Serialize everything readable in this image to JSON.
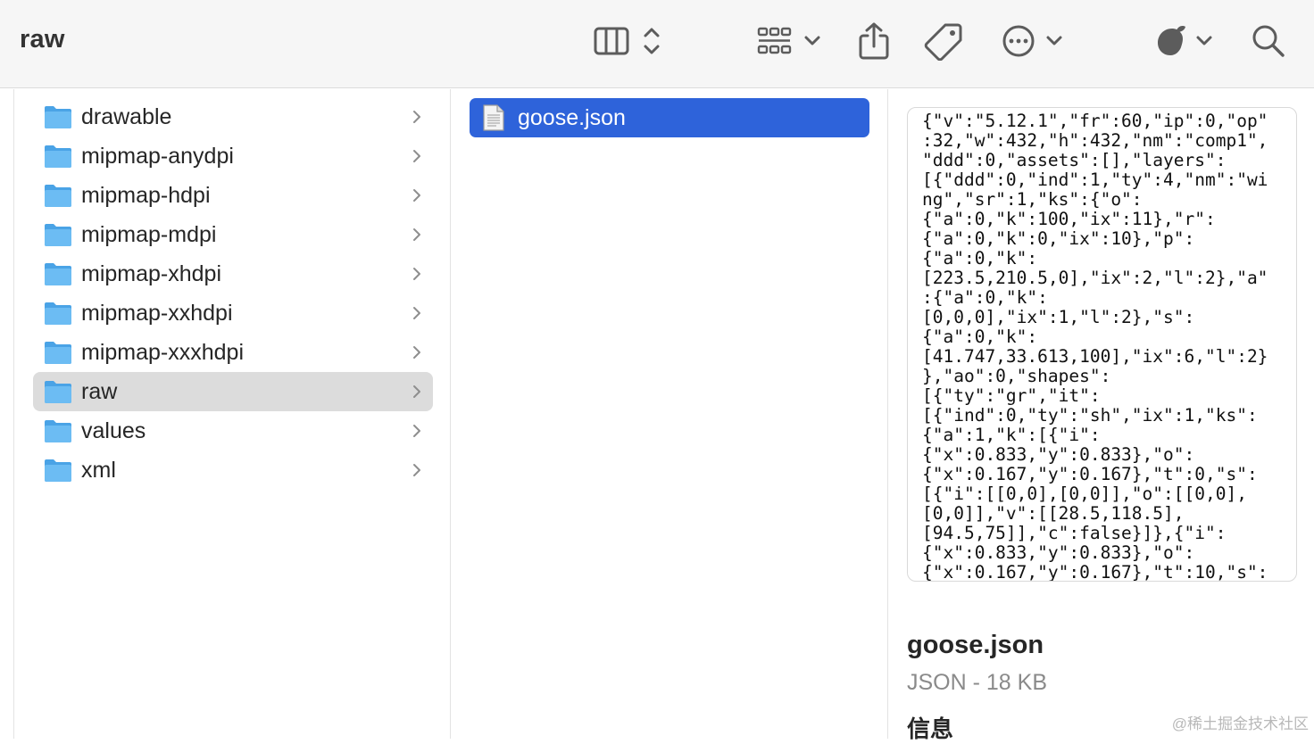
{
  "window": {
    "title": "raw"
  },
  "toolbar": {
    "view_icon": "column-view-icon",
    "group_icon": "group-grid-icon",
    "share_icon": "share-icon",
    "tag_icon": "tag-icon",
    "more_icon": "more-actions-icon",
    "extension_icon": "extension-icon",
    "search_icon": "search-icon"
  },
  "sidebar_column": {
    "items": [
      {
        "label": "drawable"
      },
      {
        "label": "mipmap-anydpi"
      },
      {
        "label": "mipmap-hdpi"
      },
      {
        "label": "mipmap-mdpi"
      },
      {
        "label": "mipmap-xhdpi"
      },
      {
        "label": "mipmap-xxhdpi"
      },
      {
        "label": "mipmap-xxxhdpi"
      },
      {
        "label": "raw",
        "selected": true
      },
      {
        "label": "values"
      },
      {
        "label": "xml"
      }
    ]
  },
  "files_column": {
    "items": [
      {
        "label": "goose.json",
        "selected": true
      }
    ]
  },
  "preview": {
    "lines": [
      "{\"v\":\"5.12.1\",\"fr\":60,\"ip\":0,\"op\"",
      ":32,\"w\":432,\"h\":432,\"nm\":\"comp1\",",
      "\"ddd\":0,\"assets\":[],\"layers\":",
      "[{\"ddd\":0,\"ind\":1,\"ty\":4,\"nm\":\"wi",
      "ng\",\"sr\":1,\"ks\":{\"o\":",
      "{\"a\":0,\"k\":100,\"ix\":11},\"r\":",
      "{\"a\":0,\"k\":0,\"ix\":10},\"p\":",
      "{\"a\":0,\"k\":",
      "[223.5,210.5,0],\"ix\":2,\"l\":2},\"a\"",
      ":{\"a\":0,\"k\":",
      "[0,0,0],\"ix\":1,\"l\":2},\"s\":",
      "{\"a\":0,\"k\":",
      "[41.747,33.613,100],\"ix\":6,\"l\":2}",
      "},\"ao\":0,\"shapes\":",
      "[{\"ty\":\"gr\",\"it\":",
      "[{\"ind\":0,\"ty\":\"sh\",\"ix\":1,\"ks\":",
      "{\"a\":1,\"k\":[{\"i\":",
      "{\"x\":0.833,\"y\":0.833},\"o\":",
      "{\"x\":0.167,\"y\":0.167},\"t\":0,\"s\":",
      "[{\"i\":[[0,0],[0,0]],\"o\":[[0,0],",
      "[0,0]],\"v\":[[28.5,118.5],",
      "[94.5,75]],\"c\":false}]},{\"i\":",
      "{\"x\":0.833,\"y\":0.833},\"o\":",
      "{\"x\":0.167,\"y\":0.167},\"t\":10,\"s\":"
    ]
  },
  "info": {
    "name": "goose.json",
    "kind": "JSON - 18 KB",
    "section_title": "信息"
  },
  "watermark": "@稀土掘金技术社区",
  "colors": {
    "selection_blue": "#2e63da",
    "selection_gray": "#dcdcdc",
    "folder_blue": "#5db3ee",
    "toolbar_bg": "#f6f6f6"
  }
}
